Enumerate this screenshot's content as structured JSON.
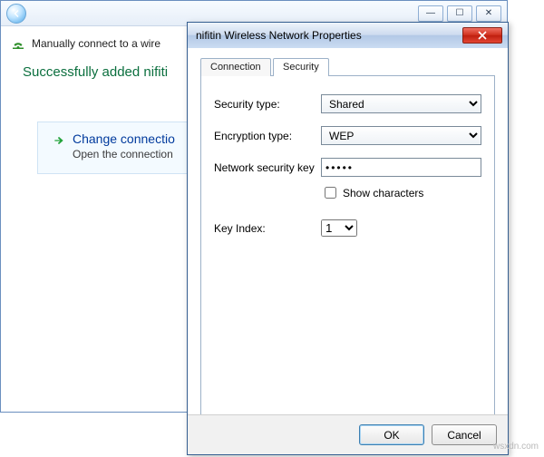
{
  "wizard": {
    "breadcrumb": "Manually connect to a wire",
    "heading": "Successfully added nifiti",
    "action": {
      "title": "Change connectio",
      "subtitle": "Open the connection"
    },
    "window_buttons": {
      "min": "—",
      "max": "☐",
      "close": "✕"
    }
  },
  "dialog": {
    "title": "nifitin Wireless Network Properties",
    "tabs": {
      "connection": "Connection",
      "security": "Security"
    },
    "fields": {
      "security_type": {
        "label": "Security type:",
        "value": "Shared"
      },
      "encryption_type": {
        "label": "Encryption type:",
        "value": "WEP"
      },
      "network_key": {
        "label": "Network security key",
        "value": "•••••"
      },
      "show_chars": {
        "label": "Show characters",
        "checked": false
      },
      "key_index": {
        "label": "Key Index:",
        "value": "1"
      }
    },
    "buttons": {
      "ok": "OK",
      "cancel": "Cancel"
    }
  },
  "watermark": "wsxdn.com"
}
